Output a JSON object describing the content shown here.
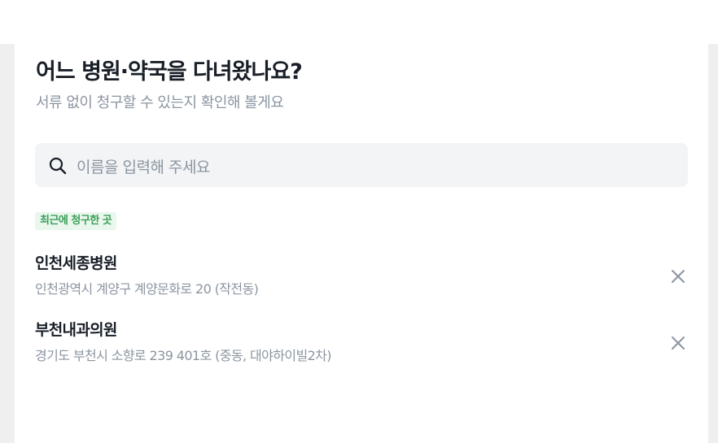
{
  "header": {
    "title": "어느 병원·약국을 다녀왔나요?",
    "subtitle": "서류 없이 청구할 수 있는지 확인해 볼게요"
  },
  "search": {
    "placeholder": "이름을 입력해 주세요",
    "icon": "search-icon"
  },
  "recent": {
    "badge": "최근에 청구한 곳",
    "items": [
      {
        "name": "인천세종병원",
        "address": "인천광역시 계양구 계양문화로 20 (작전동)"
      },
      {
        "name": "부천내과의원",
        "address": "경기도 부천시 소향로 239 401호 (중동, 대야하이빌2차)"
      }
    ]
  },
  "colors": {
    "accent_green": "#3c9f5b",
    "badge_bg": "#e9f7ec",
    "text_primary": "#191f28",
    "text_secondary": "#8b95a1",
    "input_bg": "#f2f4f6"
  }
}
